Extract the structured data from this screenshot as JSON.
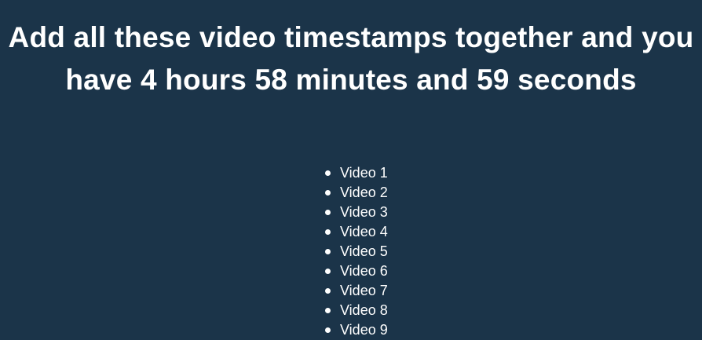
{
  "heading": "Add all these video timestamps together and you have 4 hours 58 minutes and 59 seconds",
  "videos": [
    "Video 1",
    "Video 2",
    "Video 3",
    "Video 4",
    "Video 5",
    "Video 6",
    "Video 7",
    "Video 8",
    "Video 9"
  ],
  "colors": {
    "background": "#1b3449",
    "text": "#ffffff"
  }
}
